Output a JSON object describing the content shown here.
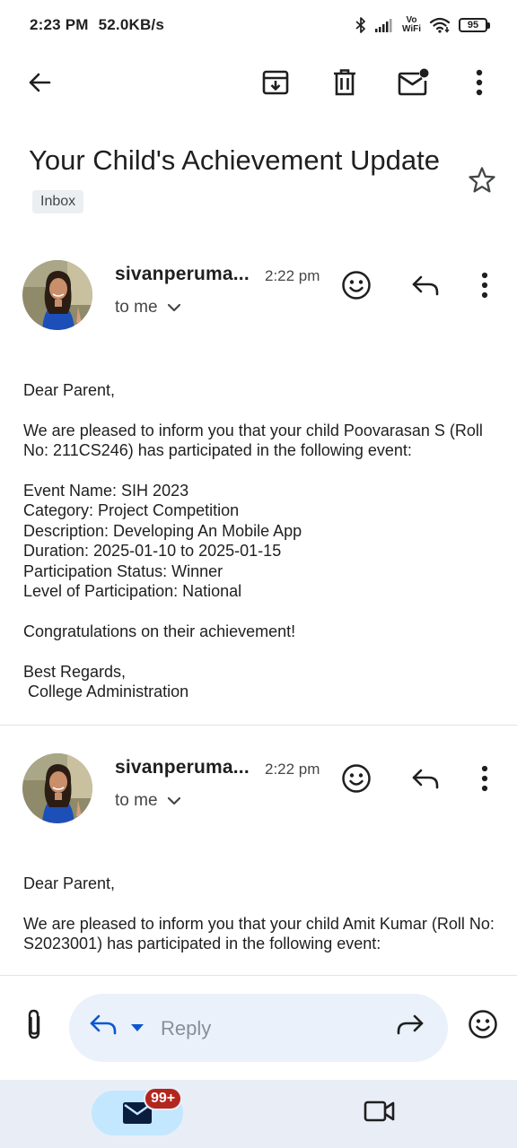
{
  "status_bar": {
    "time": "2:23 PM",
    "network_speed": "52.0KB/s",
    "volte_line1": "Vo",
    "volte_line2": "WiFi",
    "battery_level": "95",
    "icons": [
      "bluetooth-icon",
      "signal-icon",
      "vowifi-icon",
      "wifi-icon",
      "battery-icon"
    ]
  },
  "toolbar": {
    "icons": [
      "back-arrow-icon",
      "archive-icon",
      "delete-icon",
      "mark-unread-icon",
      "more-vert-icon"
    ]
  },
  "subject": {
    "title": "Your Child's Achievement Update",
    "label": "Inbox",
    "starred": false
  },
  "messages": [
    {
      "sender": "sivanperuma...",
      "time": "2:22 pm",
      "recipients": "to me",
      "body": [
        "Dear Parent,",
        "",
        "We are pleased to inform you that your child Poovarasan S (Roll No: 211CS246) has participated in the following event:",
        "",
        "Event Name: SIH 2023",
        "Category: Project Competition",
        "Description: Developing An Mobile App",
        "Duration: 2025-01-10 to 2025-01-15",
        "Participation Status: Winner",
        "Level of Participation: National",
        "",
        "Congratulations on their achievement!",
        "",
        "Best Regards,",
        " College Administration"
      ]
    },
    {
      "sender": "sivanperuma...",
      "time": "2:22 pm",
      "recipients": "to me",
      "body": [
        "Dear Parent,",
        "",
        "We are pleased to inform you that your child Amit Kumar (Roll No: S2023001) has participated in the following event:"
      ]
    }
  ],
  "reply_bar": {
    "placeholder": "Reply",
    "icons": [
      "attach-icon",
      "reply-icon",
      "caret-down-icon",
      "forward-icon",
      "emoji-icon"
    ]
  },
  "bottom_nav": {
    "mail_badge": "99+",
    "icons": [
      "mail-icon",
      "video-icon"
    ]
  },
  "colors": {
    "accent": "#0b57d0",
    "chip_background": "#eceff1",
    "reply_pill": "#eaf1fb",
    "nav_background": "#e9eef6",
    "nav_active": "#c2e7ff",
    "badge": "#b3261e"
  }
}
